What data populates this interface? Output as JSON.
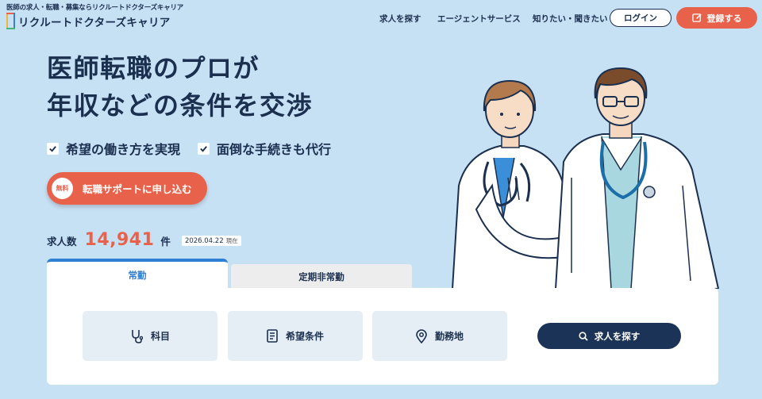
{
  "header": {
    "tagline": "医師の求人・転職・募集ならリクルートドクターズキャリア",
    "logo_text": "リクルートドクターズキャリア",
    "nav": [
      "求人を探す",
      "エージェントサービス",
      "知りたい・聞きたい"
    ],
    "login_label": "ログイン",
    "register_label": "登録する"
  },
  "hero": {
    "headline_line1": "医師転職のプロが",
    "headline_line2": "年収などの条件を交渉",
    "checks": [
      "希望の働き方を実現",
      "面倒な手続きも代行"
    ],
    "cta_badge": "無料",
    "cta_label": "転職サポートに申し込む"
  },
  "job_count": {
    "label": "求人数",
    "number": "14,941",
    "unit": "件",
    "date": "2026.04.22",
    "date_suffix": "現在"
  },
  "tabs": [
    "常勤",
    "定期非常勤"
  ],
  "filters": {
    "specialty": "科目",
    "conditions": "希望条件",
    "location": "勤務地"
  },
  "search_label": "求人を探す",
  "colors": {
    "background": "#c6e0f4",
    "navy": "#1b2f4e",
    "accent": "#e8624b",
    "tab_active": "#2f7fd4"
  }
}
